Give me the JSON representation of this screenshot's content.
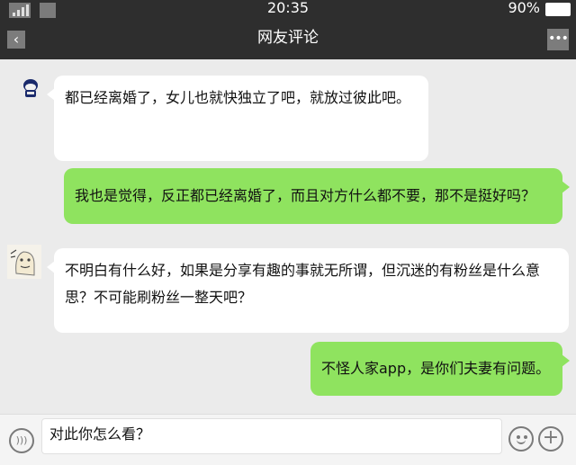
{
  "status_bar": {
    "time": "20:35",
    "battery": "90%"
  },
  "header": {
    "title": "网友评论",
    "back_icon": "chevron-left-icon",
    "more_icon": "more-icon"
  },
  "messages": [
    {
      "side": "left",
      "text": "都已经离婚了，女儿也就快独立了吧，就放过彼此吧。"
    },
    {
      "side": "right",
      "text": "我也是觉得，反正都已经离婚了，而且对方什么都不要，那不是挺好吗？"
    },
    {
      "side": "left",
      "text": "不明白有什么好，如果是分享有趣的事就无所谓，但沉迷的有粉丝是什么意思？不可能刷粉丝一整天吧？"
    },
    {
      "side": "right",
      "text": "不怪人家app，是你们夫妻有问题。"
    }
  ],
  "input": {
    "value": "对此你怎么看？"
  },
  "colors": {
    "bar": "#2e2e2e",
    "background": "#ebebeb",
    "bubble_right": "#8fe35f",
    "bubble_left": "#ffffff"
  }
}
